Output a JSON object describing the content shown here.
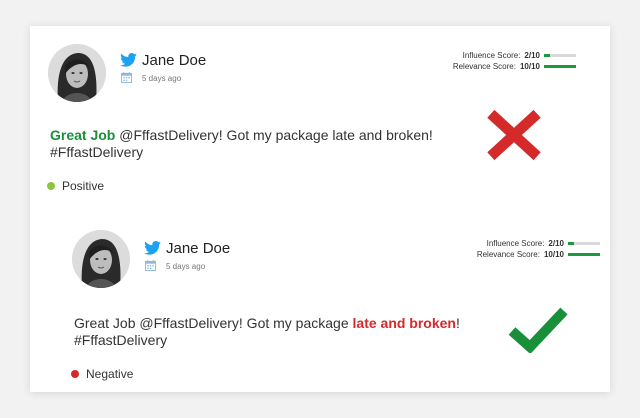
{
  "tweets": [
    {
      "author": "Jane Doe",
      "timestamp": "5 days ago",
      "scores": {
        "influence_label": "Influence Score:",
        "influence_value": "2/10",
        "influence_level": 0.2,
        "relevance_label": "Relevance Score:",
        "relevance_value": "10/10",
        "relevance_level": 1.0
      },
      "text_part1": "Great Job",
      "text_part2": " @FffastDelivery! Got my package late and broken!",
      "text_line2": "#FffastDelivery",
      "highlight": "positive",
      "sentiment": "Positive",
      "sentiment_color": "#8cc63f",
      "verdict": "x-mark-icon",
      "verdict_color": "#d42a2a"
    },
    {
      "author": "Jane Doe",
      "timestamp": "5 days ago",
      "scores": {
        "influence_label": "Influence Score:",
        "influence_value": "2/10",
        "influence_level": 0.2,
        "relevance_label": "Relevance Score:",
        "relevance_value": "10/10",
        "relevance_level": 1.0
      },
      "text_part1": "Great Job @FffastDelivery! Got my package ",
      "text_part2": "late and broken",
      "text_part3": "!",
      "text_line2": "#FffastDelivery",
      "highlight": "negative",
      "sentiment": "Negative",
      "sentiment_color": "#d42a2a",
      "verdict": "check-mark-icon",
      "verdict_color": "#1a8f3a"
    }
  ],
  "colors": {
    "twitter_blue": "#1da1f2",
    "score_fill": "#1a9a3e",
    "score_track": "#d9d9d9"
  }
}
